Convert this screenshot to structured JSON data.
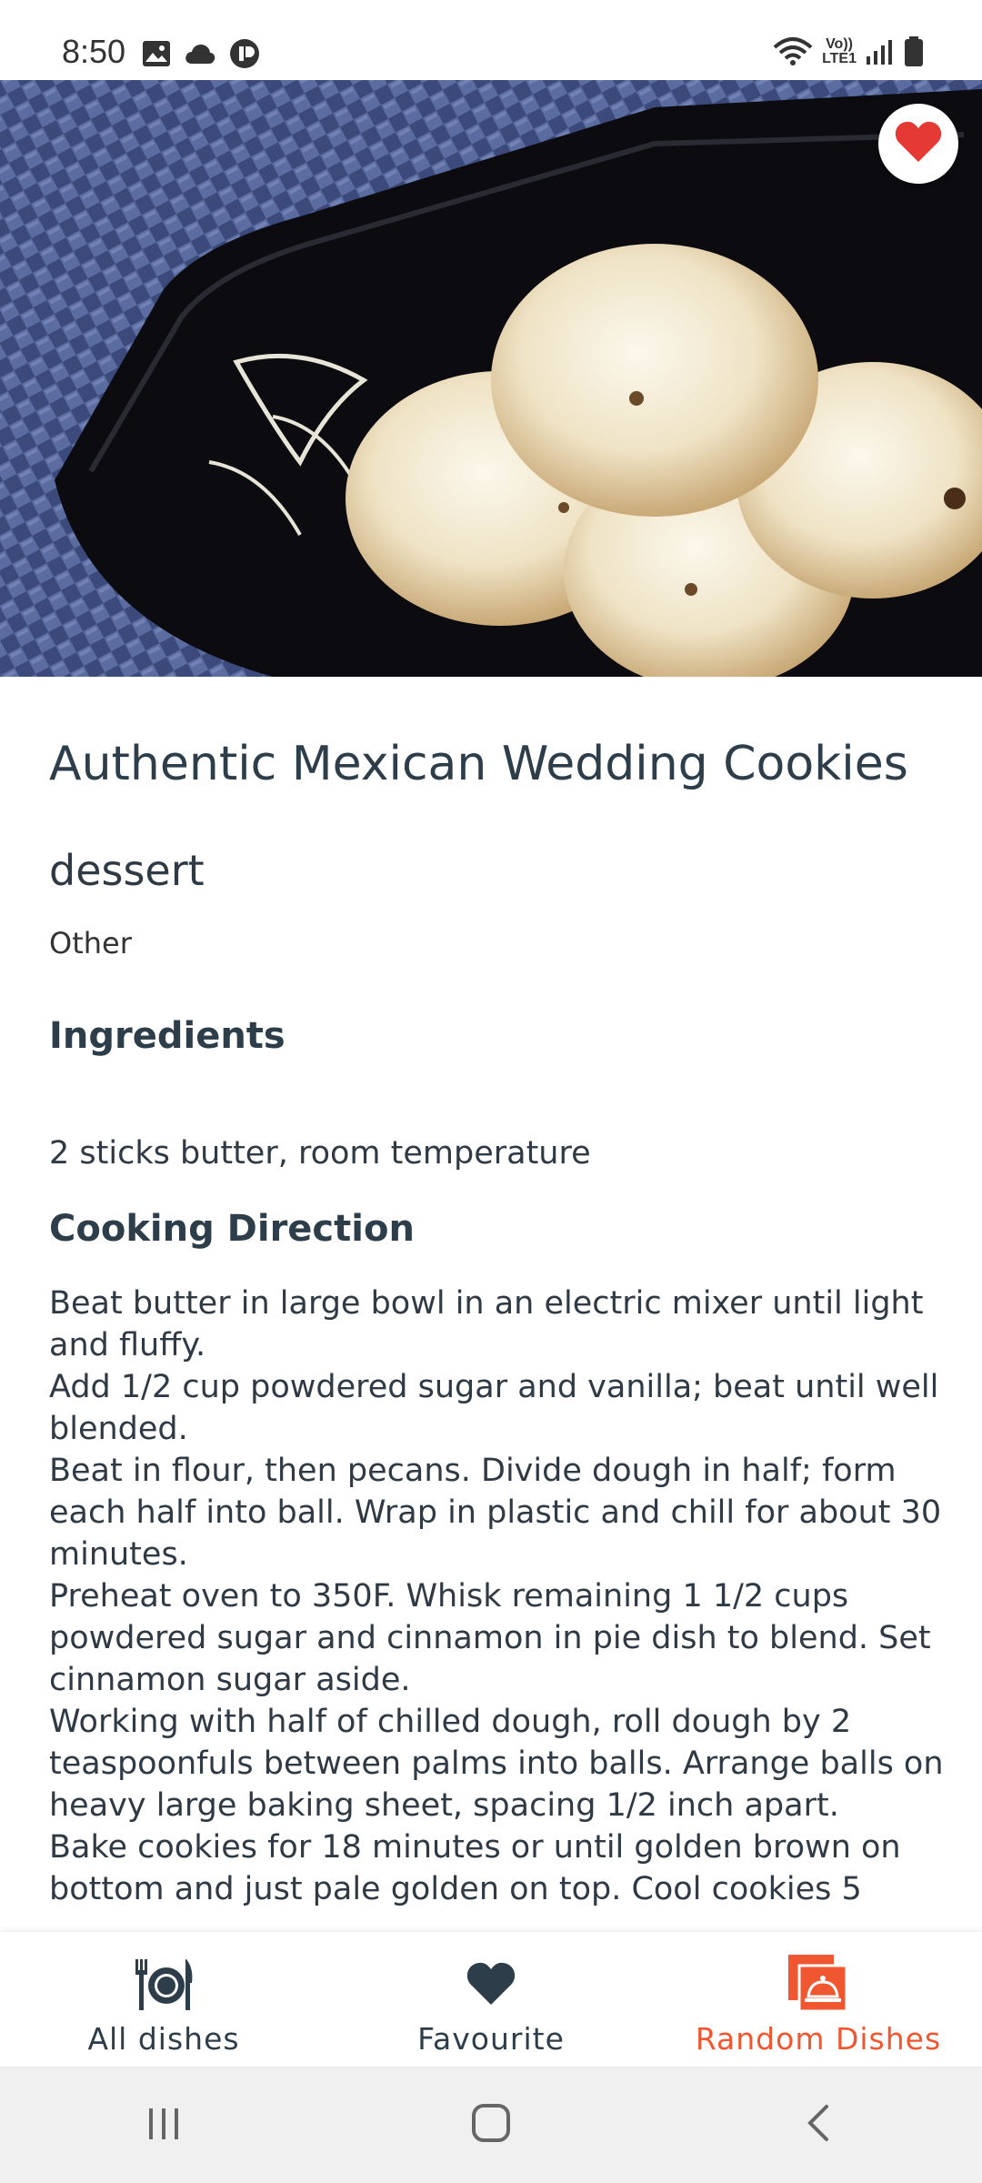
{
  "status_bar": {
    "time": "8:50",
    "network_label_top": "Vo))",
    "network_label_bottom": "LTE1"
  },
  "hero": {
    "image_icon": "cookies-photo",
    "favourite_icon": "heart-icon",
    "favourite_active": true
  },
  "dish": {
    "title": "Authentic Mexican Wedding Cookies",
    "type": "dessert",
    "category": "Other"
  },
  "ingredients": {
    "heading": "Ingredients",
    "text": "2 sticks butter, room temperature"
  },
  "directions": {
    "heading": "Cooking Direction",
    "text": "Beat butter in large bowl in an electric mixer until light and fluffy.\nAdd 1/2 cup powdered sugar and vanilla; beat until well blended.\nBeat in flour, then pecans. Divide dough in half; form each half into ball. Wrap in plastic and chill for about 30 minutes.\nPreheat oven to 350F. Whisk remaining 1 1/2 cups powdered sugar and cinnamon in pie dish to blend. Set cinnamon sugar aside.\nWorking with half of chilled dough, roll dough by 2 teaspoonfuls between palms into balls. Arrange balls on heavy large baking sheet, spacing 1/2 inch apart.\nBake cookies for 18 minutes or until golden brown on bottom and just pale golden on top. Cool cookies 5"
  },
  "bottom_nav": {
    "items": [
      {
        "label": "All dishes",
        "icon": "plate-cutlery-icon",
        "active": false
      },
      {
        "label": "Favourite",
        "icon": "heart-icon",
        "active": false
      },
      {
        "label": "Random Dishes",
        "icon": "random-dish-icon",
        "active": true
      }
    ]
  },
  "colors": {
    "accent": "#f0562f",
    "heart": "#e53935",
    "text_dark": "#2d3e4a"
  }
}
